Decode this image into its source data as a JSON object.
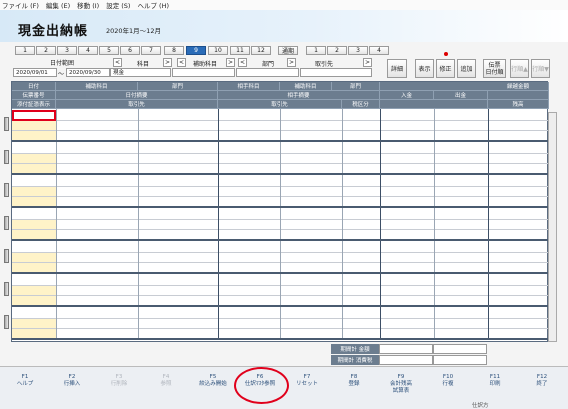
{
  "menu": [
    "ファイル (F)",
    "編集 (E)",
    "移動 (I)",
    "設定 (S)",
    "ヘルプ (H)"
  ],
  "title": "現金出納帳",
  "period": "2020年1月〜12月",
  "months": [
    "1",
    "2",
    "3",
    "4",
    "5",
    "6",
    "7",
    "8",
    "9",
    "10",
    "11",
    "12"
  ],
  "selected_month": "9",
  "accounting_label": "通期",
  "quarters": [
    "1",
    "2",
    "3",
    "4"
  ],
  "filters": {
    "date_range_label": "日付範囲",
    "date_from": "2020/09/01",
    "tilde": "〜",
    "date_to": "2020/09/30",
    "cash_label": "現金",
    "subject_label": "科目",
    "sub_subject_label": "補助科目",
    "dept_label": "部門",
    "partner_label": "取引先",
    "prev_arrow": "<",
    "next_arrow": ">"
  },
  "toolbar": {
    "detail": "詳細",
    "display": "表示",
    "edit": "修正",
    "add": "追加",
    "voucher": "伝票",
    "voucher2": "日付順",
    "row_up": "行順▲",
    "row_down": "行順▼"
  },
  "headers": {
    "date": "日付",
    "voucher_no": "伝票番号",
    "evidence": "添付証憑表示",
    "sub_account": "補助科目",
    "dept": "部門",
    "counter_account": "相手科目",
    "counter_sub": "補助科目",
    "counter_dept": "部門",
    "balance_carry": "繰越金額",
    "daily_summary": "日付摘要",
    "counter_summary": "相手摘要",
    "deposit": "入金",
    "withdrawal": "出金",
    "partner": "取引先",
    "partner2": "取引先",
    "tax": "税区分",
    "balance": "残高"
  },
  "totals": {
    "period_total": "期間計 金額",
    "period_tax": "期間計 消費税"
  },
  "fkeys": [
    {
      "key": "F1",
      "label": "ヘルプ",
      "enabled": true
    },
    {
      "key": "F2",
      "label": "行挿入",
      "enabled": true
    },
    {
      "key": "F3",
      "label": "行削除",
      "enabled": false
    },
    {
      "key": "F4",
      "label": "参照",
      "enabled": false
    },
    {
      "key": "F5",
      "label": "絞込み開始",
      "enabled": true
    },
    {
      "key": "F6",
      "label": "仕訳ﾏｽﾀ参照",
      "enabled": true
    },
    {
      "key": "F7",
      "label": "リセット",
      "enabled": true
    },
    {
      "key": "F8",
      "label": "登録",
      "enabled": true
    },
    {
      "key": "F9",
      "label": "会計残高\n試算表",
      "enabled": true
    },
    {
      "key": "F10",
      "label": "行複",
      "enabled": true
    },
    {
      "key": "F11",
      "label": "印刷",
      "enabled": true
    },
    {
      "key": "F12",
      "label": "終了",
      "enabled": true
    }
  ],
  "status_text": "仕訳方"
}
